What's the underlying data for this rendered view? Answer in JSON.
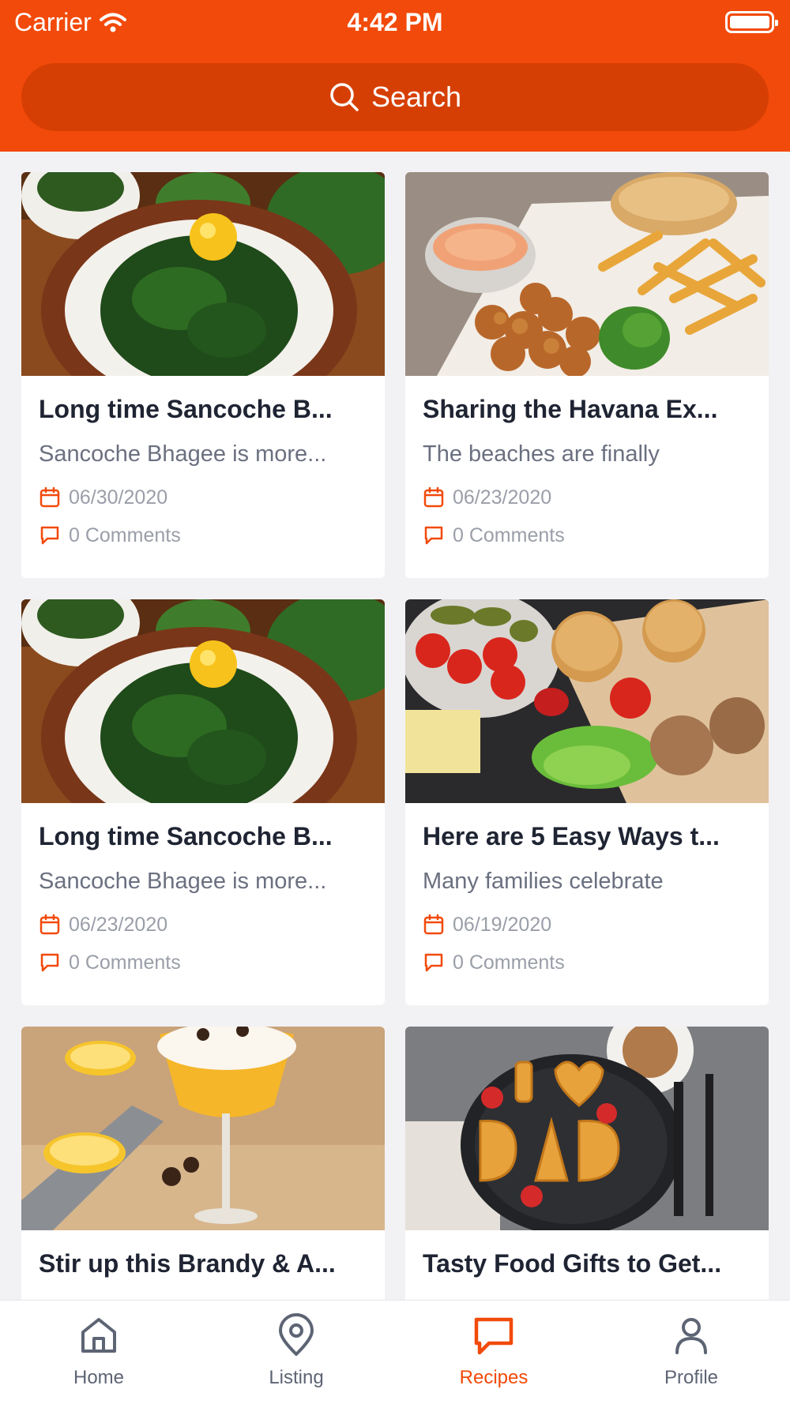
{
  "status": {
    "carrier": "Carrier",
    "time": "4:42 PM"
  },
  "search": {
    "label": "Search"
  },
  "cards": [
    {
      "title": "Long time Sancoche B...",
      "desc": "Sancoche Bhagee is more...",
      "date": "06/30/2020",
      "comments": "0 Comments",
      "image": "rice-greens-bowl"
    },
    {
      "title": "Sharing the Havana Ex...",
      "desc": "The beaches are finally",
      "date": "06/23/2020",
      "comments": "0 Comments",
      "image": "fried-chicken-fries"
    },
    {
      "title": "Long time Sancoche B...",
      "desc": "Sancoche Bhagee is more...",
      "date": "06/23/2020",
      "comments": "0 Comments",
      "image": "rice-greens-bowl"
    },
    {
      "title": "Here are 5 Easy Ways t...",
      "desc": "Many families celebrate",
      "date": "06/19/2020",
      "comments": "0 Comments",
      "image": "burger-ingredients"
    },
    {
      "title": "Stir up this Brandy & A...",
      "desc": "",
      "date": "",
      "comments": "",
      "image": "cocktail-glass"
    },
    {
      "title": "Tasty Food Gifts to Get...",
      "desc": "",
      "date": "",
      "comments": "",
      "image": "dad-pancakes"
    }
  ],
  "tabs": [
    {
      "label": "Home",
      "icon": "home-icon"
    },
    {
      "label": "Listing",
      "icon": "location-pin-icon"
    },
    {
      "label": "Recipes",
      "icon": "chat-bubble-icon",
      "active": true
    },
    {
      "label": "Profile",
      "icon": "user-icon"
    }
  ],
  "colors": {
    "accent": "#f24a0a",
    "search_bg": "#d63f04",
    "background": "#f2f2f5"
  }
}
